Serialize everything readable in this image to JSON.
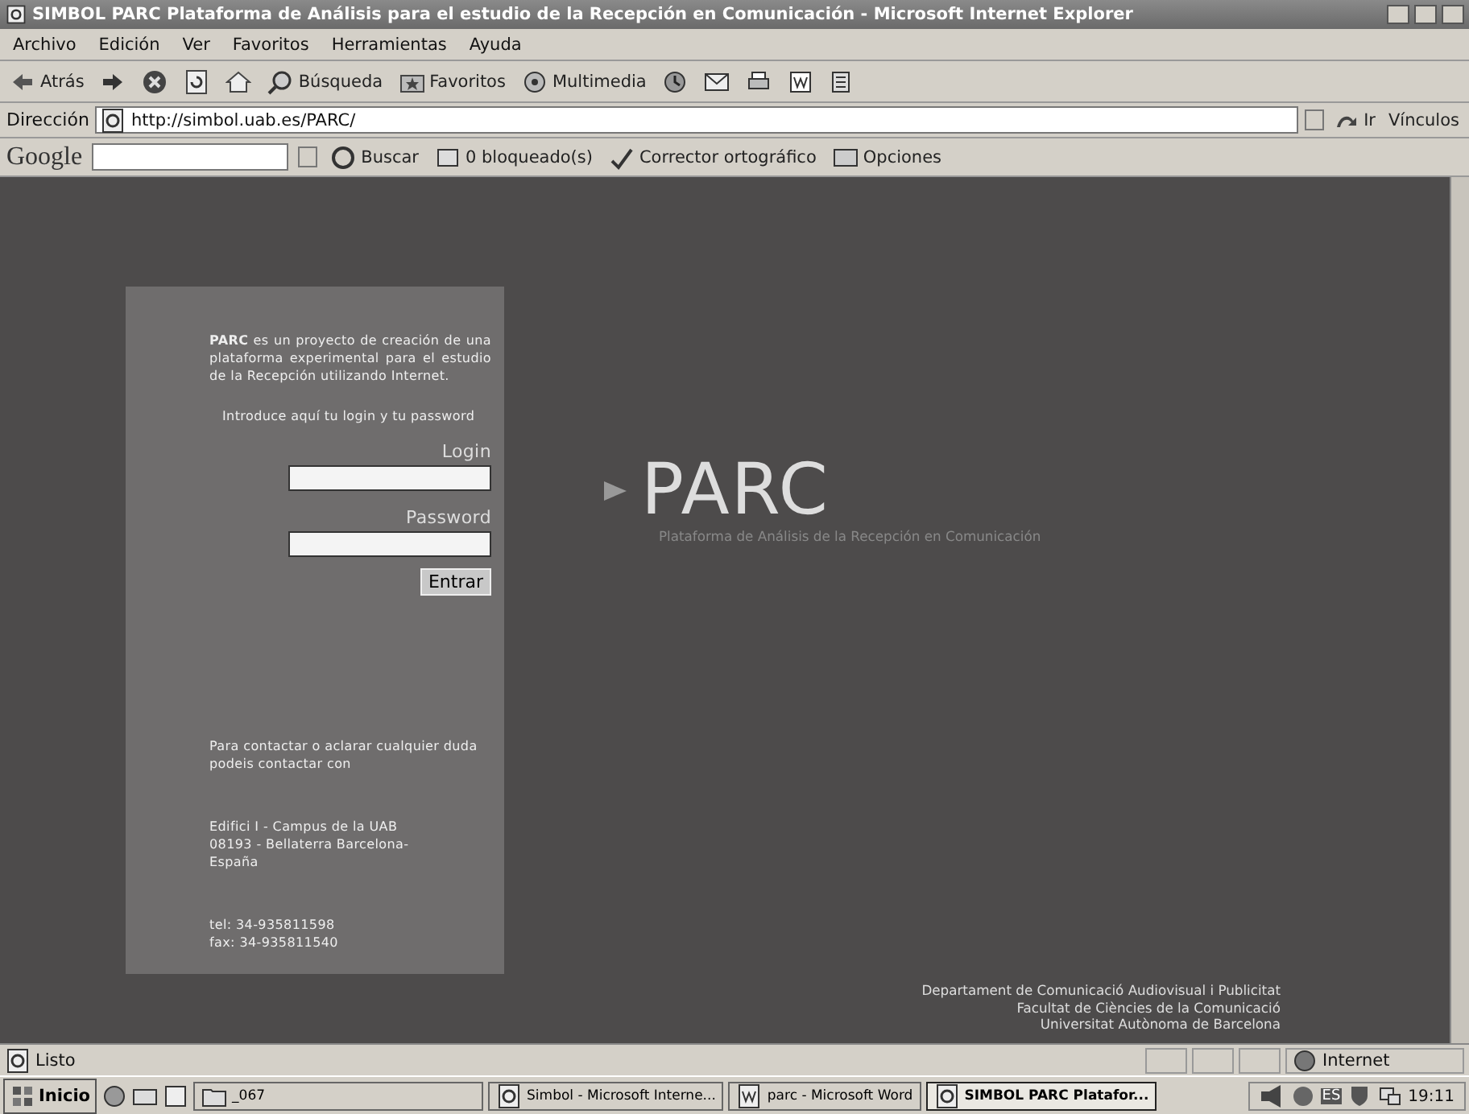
{
  "window": {
    "title": "SIMBOL PARC Plataforma de Análisis para el estudio de la Recepción en Comunicación - Microsoft Internet Explorer"
  },
  "menu": [
    "Archivo",
    "Edición",
    "Ver",
    "Favoritos",
    "Herramientas",
    "Ayuda"
  ],
  "toolbar": [
    {
      "kind": "back",
      "label": "Atrás"
    },
    {
      "kind": "forward"
    },
    {
      "kind": "stop"
    },
    {
      "kind": "refresh"
    },
    {
      "kind": "home"
    },
    {
      "kind": "search",
      "label": "Búsqueda"
    },
    {
      "kind": "favorites",
      "label": "Favoritos"
    },
    {
      "kind": "media",
      "label": "Multimedia"
    },
    {
      "kind": "history"
    },
    {
      "kind": "mail"
    },
    {
      "kind": "print"
    },
    {
      "kind": "edit"
    },
    {
      "kind": "discuss"
    }
  ],
  "address": {
    "label": "Dirección",
    "value": "http://simbol.uab.es/PARC/",
    "go": "Ir",
    "links": "Vínculos"
  },
  "google_bar": {
    "logo": "Google",
    "buttons": [
      "Buscar",
      "0 bloqueado(s)",
      "Corrector ortográfico",
      "Opciones"
    ]
  },
  "panel": {
    "intro": "**PARC** es un proyecto de creación de una plataforma experimental para el estudio de la Recepción utilizando Internet.",
    "prompt": "Introduce aquí tu login y tu password",
    "login_label": "Login",
    "password_label": "Password",
    "submit": "Entrar",
    "contact": "Para contactar o aclarar cualquier duda podeis contactar con",
    "address_lines": [
      "Edifici I - Campus de la UAB",
      "08193 - Bellaterra Barcelona-",
      "España"
    ],
    "phone_lines": [
      "tel: 34-935811598",
      "fax: 34-935811540"
    ]
  },
  "logo": {
    "name": "PARC",
    "subtitle": "Plataforma de Análisis de la Recepción en Comunicación"
  },
  "footer": [
    "Departament de Comunicació Audiovisual i Publicitat",
    "Facultat de Ciències de la Comunicació",
    "Universitat Autònoma de Barcelona"
  ],
  "status_bar": {
    "text": "Listo",
    "zone": "Internet"
  },
  "taskbar": {
    "start": "Inicio",
    "buttons": [
      {
        "label": "_067",
        "kind": "folder",
        "selected": false
      },
      {
        "label": "Simbol - Microsoft Interne...",
        "kind": "ie",
        "selected": false
      },
      {
        "label": "parc - Microsoft Word",
        "kind": "word",
        "selected": false
      },
      {
        "label": "SIMBOL PARC Platafor...",
        "kind": "ie",
        "selected": true
      }
    ],
    "language": "ES",
    "clock": "19:11"
  }
}
